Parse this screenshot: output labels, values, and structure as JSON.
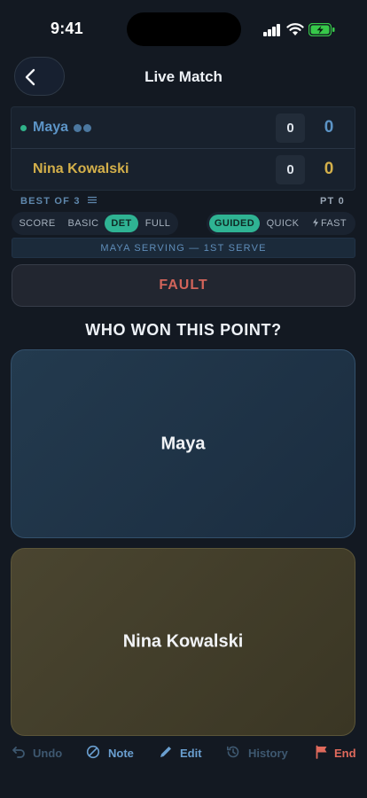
{
  "status_bar": {
    "time": "9:41"
  },
  "header": {
    "title": "Live Match"
  },
  "players": [
    {
      "name": "Maya",
      "games": "0",
      "points": "0",
      "serving": true
    },
    {
      "name": "Nina Kowalski",
      "games": "0",
      "points": "0",
      "serving": false
    }
  ],
  "match": {
    "best_of": "BEST OF 3",
    "pt_label": "PT 0"
  },
  "mode_options": [
    "SCORE",
    "BASIC",
    "DET",
    "FULL"
  ],
  "mode_selected": "DET",
  "speed_options": [
    "GUIDED",
    "QUICK",
    "FAST"
  ],
  "speed_selected": "GUIDED",
  "serve_banner": "MAYA SERVING — 1ST SERVE",
  "fault_label": "FAULT",
  "question": "WHO WON THIS POINT?",
  "toolbar": {
    "undo": "Undo",
    "note": "Note",
    "edit": "Edit",
    "history": "History",
    "end": "End"
  },
  "colors": {
    "player_a": "#5c94c6",
    "player_b": "#d4b04a",
    "accent": "#2fb393",
    "fault": "#d2645a",
    "end": "#e06a5c"
  }
}
